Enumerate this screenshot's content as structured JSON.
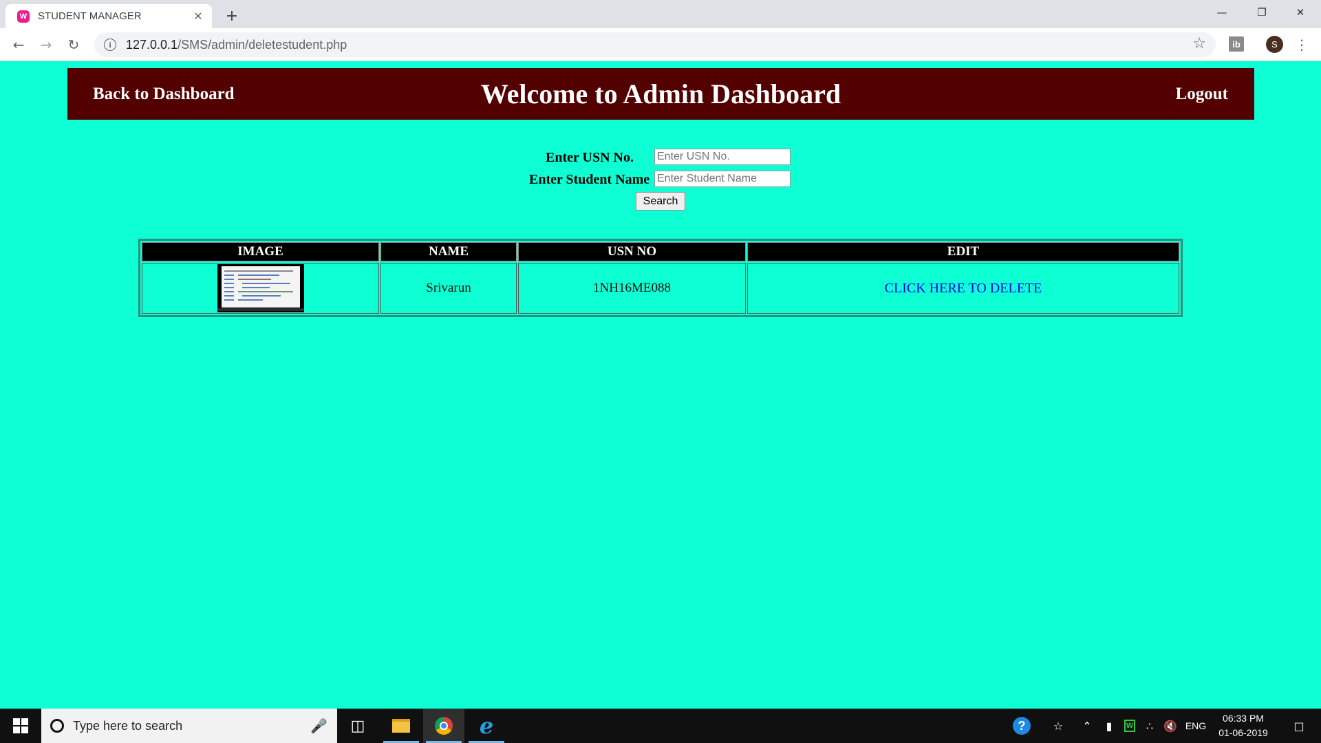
{
  "browser": {
    "tab_title": "STUDENT MANAGER",
    "tab_favicon": "W",
    "tab_close": "✕",
    "new_tab": "+",
    "url_host": "127.0.0.1",
    "url_path": "/SMS/admin/deletestudent.php",
    "extension_label": "ib",
    "profile_initial": "S",
    "icons": [
      "back-arrow-icon",
      "forward-arrow-icon",
      "reload-icon",
      "info-icon",
      "star-icon",
      "menu-icon"
    ]
  },
  "header": {
    "back_link": "Back to Dashboard",
    "title": "Welcome to Admin Dashboard",
    "logout_link": "Logout",
    "background_color": "#520000"
  },
  "search": {
    "usn_label": "Enter USN No.",
    "usn_placeholder": "Enter USN No.",
    "name_label": "Enter Student Name",
    "name_placeholder": "Enter Student Name",
    "button_label": "Search"
  },
  "table": {
    "headers": {
      "image": "IMAGE",
      "name": "NAME",
      "usn": "USN NO",
      "edit": "EDIT"
    },
    "rows": [
      {
        "name": "Srivarun",
        "usn": "1NH16ME088",
        "action": "CLICK HERE TO DELETE"
      }
    ]
  },
  "taskbar": {
    "search_placeholder": "Type here to search",
    "language": "ENG",
    "time": "06:33 PM",
    "date": "01-06-2019"
  },
  "colors": {
    "page_background": "#0fffd4",
    "link": "#0000ee"
  }
}
